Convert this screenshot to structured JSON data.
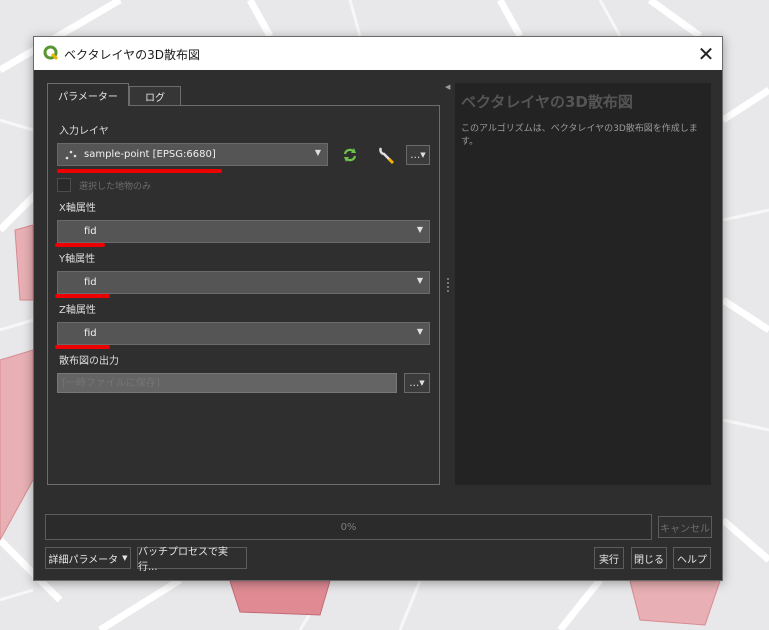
{
  "window": {
    "title": "ベクタレイヤの3D散布図",
    "close_glyph": "✕"
  },
  "tabs": [
    {
      "label": "パラメーター"
    },
    {
      "label": "ログ"
    }
  ],
  "params": {
    "input_layer_label": "入力レイヤ",
    "input_layer_value": "sample-point [EPSG:6680]",
    "selected_only_label": "選択した地物のみ",
    "selected_only_checked": false,
    "x_label": "X軸属性",
    "x_value": "fid",
    "y_label": "Y軸属性",
    "y_value": "fid",
    "z_label": "Z軸属性",
    "z_value": "fid",
    "output_label": "散布図の出力",
    "output_placeholder": "[一時ファイルに保存]",
    "ellipsis": "…"
  },
  "help": {
    "title": "ベクタレイヤの3D散布図",
    "text": "このアルゴリズムは、ベクタレイヤの3D散布図を作成します。"
  },
  "progress": {
    "text": "0%",
    "value": 0
  },
  "buttons": {
    "cancel": "キャンセル",
    "advanced": "詳細パラメータ",
    "batch": "バッチプロセスで実行...",
    "run": "実行",
    "close": "閉じる",
    "help": "ヘルプ"
  },
  "icons": {
    "app": "qgis-logo-icon",
    "iterate": "iterate-icon",
    "settings": "wrench-icon",
    "layer_type": "point-layer-icon"
  },
  "colors": {
    "accent": "#589632",
    "highlight": "#ee0000",
    "polygon_fill": "#e8b0b4"
  }
}
